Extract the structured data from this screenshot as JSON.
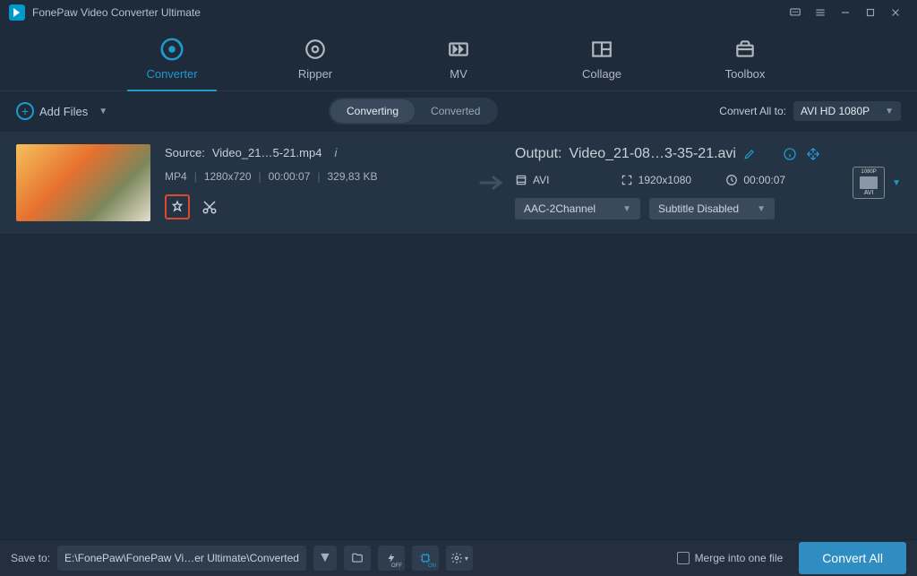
{
  "app_title": "FonePaw Video Converter Ultimate",
  "tabs": [
    {
      "label": "Converter",
      "active": true
    },
    {
      "label": "Ripper"
    },
    {
      "label": "MV"
    },
    {
      "label": "Collage"
    },
    {
      "label": "Toolbox"
    }
  ],
  "add_files_label": "Add Files",
  "segments": {
    "converting": "Converting",
    "converted": "Converted"
  },
  "convert_all_label": "Convert All to:",
  "convert_all_value": "AVI HD 1080P",
  "item": {
    "source_prefix": "Source: ",
    "source_name": "Video_21…5-21.mp4",
    "format": "MP4",
    "resolution": "1280x720",
    "duration": "00:00:07",
    "size": "329,83 KB",
    "output_prefix": "Output: ",
    "output_name": "Video_21-08…3-35-21.avi",
    "out_format": "AVI",
    "out_resolution": "1920x1080",
    "out_duration": "00:00:07",
    "audio_select": "AAC-2Channel",
    "subtitle_select": "Subtitle Disabled",
    "profile_top": "1080P",
    "profile_bot": "AVI"
  },
  "footer": {
    "saveto_label": "Save to:",
    "path": "E:\\FonePaw\\FonePaw Vi…er Ultimate\\Converted",
    "hw_off": "OFF",
    "hw_on": "ON",
    "merge_label": "Merge into one file",
    "convert_label": "Convert All"
  }
}
